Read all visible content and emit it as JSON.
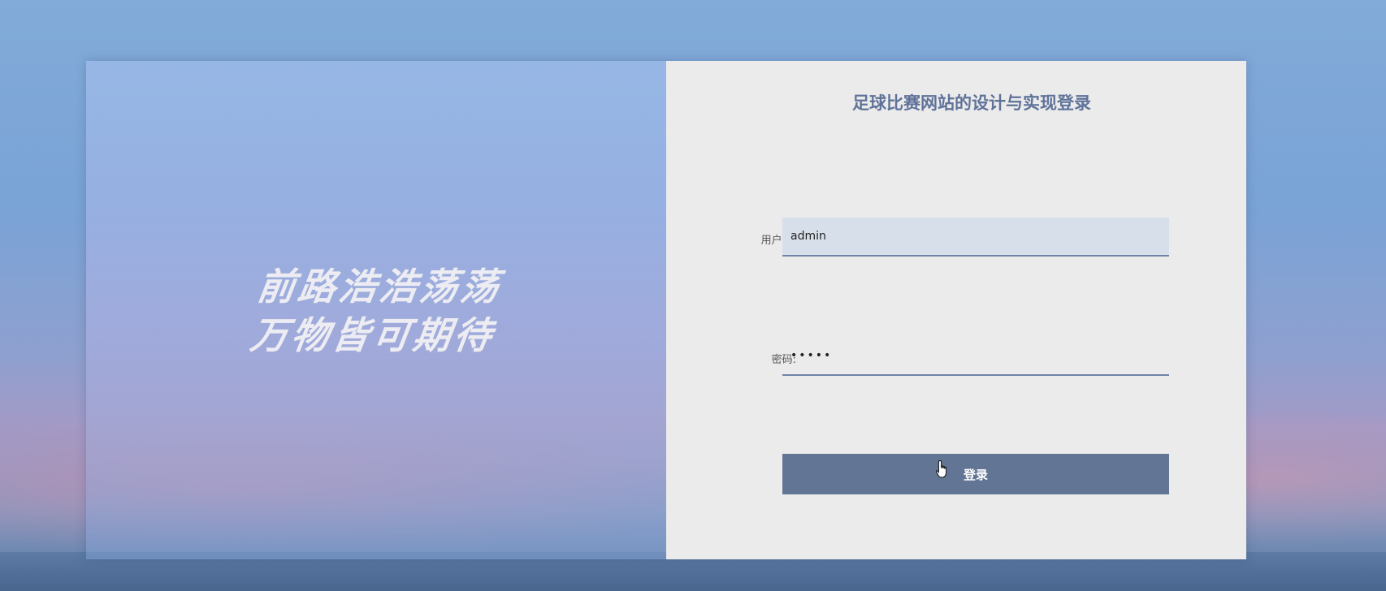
{
  "slogan": {
    "line1": "前路浩浩荡荡",
    "line2": "万物皆可期待"
  },
  "login": {
    "title": "足球比赛网站的设计与实现登录",
    "username_label": "用户名:",
    "username_value": "admin",
    "password_label": "密码:",
    "password_value": "•••••",
    "submit_label": "登录"
  },
  "colors": {
    "accent": "#637595",
    "title": "#5f7399",
    "input_underline": "#6f84a6",
    "username_bg": "#d7dfea",
    "panel_bg": "#ecebec"
  },
  "icons": {
    "cursor": "hand-pointer-icon"
  }
}
